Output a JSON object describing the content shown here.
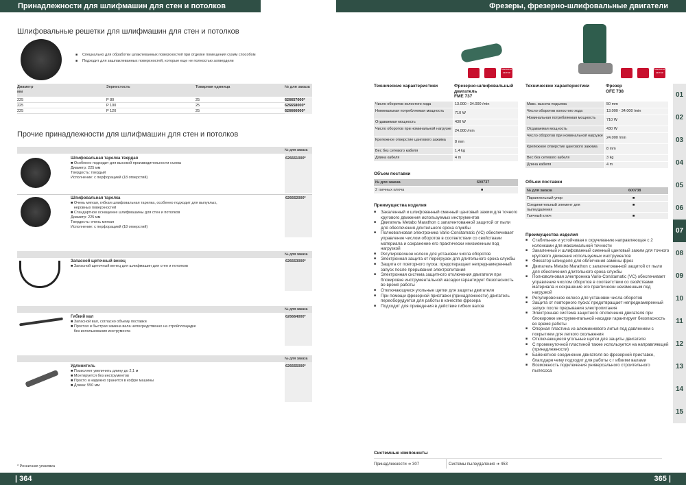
{
  "left": {
    "header": "Принадлежности для шлифмашин для стен и потолков",
    "page": "| 364",
    "sec1": "Шлифовальные решетки для шлифмашин для стен и потолков",
    "sec1_b1": "Специально для обработки шпаклеванных поверхностей при отделке помещения сухим способом",
    "sec1_b2": "Подходит для зашпаклеванных поверхностей, которые еще не полностью затвердели",
    "t1_cols": [
      "Диаметр",
      "Зернистость",
      "Товарная единица",
      "№ для заказа"
    ],
    "t1_unit": "мм",
    "t1_rows": [
      [
        "225",
        "P 80",
        "25",
        "626657000*"
      ],
      [
        "225",
        "P 100",
        "25",
        "626658000*"
      ],
      [
        "225",
        "P 120",
        "25",
        "626666000*"
      ]
    ],
    "sec2": "Прочие принадлежности для шлифмашин для стен и потолков",
    "ord_label": "№ для заказа",
    "p1": {
      "title": "Шлифовальная тарелка твердая",
      "b1": "Особенно подходит для высокой производительности съема",
      "l1": "Диаметр: 225 мм",
      "l2": "Твердость: твердый",
      "l3": "Исполнение: с перфорацией (18 отверстий)",
      "ord": "626661000*"
    },
    "p2": {
      "title": "Шлифовальная тарелка",
      "b1": "Очень мягкая, гибкая шлифовальная тарелка, особенно подходит для выпуклых,",
      "b1b": "неровных поверхностей",
      "b2": "Стандартное оснащение шлифмашины для стен и потолков",
      "l1": "Диаметр: 225 мм",
      "l2": "Твердость: очень мягкая",
      "l3": "Исполнение: с перфорацией (18 отверстий)",
      "ord": "626662000*"
    },
    "p3": {
      "title": "Запасной щеточный венец",
      "b1": "Запасной щеточный венец для шлифмашин для стен и потолков",
      "ord": "626663000*"
    },
    "p4": {
      "title": "Гибкий вал",
      "b1": "Запасной вал, согласно объему поставки",
      "b2": "Простая и быстрая замена вала непосредственно на стройплощадке",
      "b2b": "без использования инструмента",
      "ord": "626664000*"
    },
    "p5": {
      "title": "Удлинитель",
      "b1": "Позволяет увеличить длину до 2,1 м",
      "b2": "Монтируется без инструментов",
      "b3": "Просто и надежно хранится в кофре машины",
      "b4": "Длина: 550 мм",
      "ord": "626665000*"
    },
    "footnote": "* Розничная упаковка"
  },
  "right": {
    "header": "Фрезеры, фрезерно-шлифовальные двигатели",
    "page": "365 |",
    "tech_label": "Технические характеристики",
    "m1": {
      "name1": "Фрезерно-шлифовальный",
      "name2": "двигатель",
      "name3": "FME 737",
      "specs": [
        [
          "Число оборотов холостого хода",
          "13.000 - 34.000 /min"
        ],
        [
          "Номинальная потребляемая мощность",
          "710 W"
        ],
        [
          "Отдаваемая мощность",
          "430 W"
        ],
        [
          "Число оборотов при номинальной нагрузке",
          "24.000 /min"
        ],
        [
          "Крепежное отверстие цангового зажима",
          "8 mm"
        ],
        [
          "Вес без сетевого кабеля",
          "1,4 kg"
        ],
        [
          "Длина кабеля",
          "4 m"
        ]
      ],
      "delivery": "Объем поставки",
      "ord_label": "№ для заказа",
      "ord": "600737",
      "items": [
        [
          "2 гаечных ключа",
          "■"
        ]
      ],
      "adv": "Преимущества изделия",
      "bullets": [
        "Закаленный и шлифованный сменный цанговый зажим для точного кругового движения используемых инструментов",
        "Двигатель Metabo Marathon с запатентованной защитой от пыли для обеспечения длительного срока службы",
        "Полноволновая электроника Vario-Constamatic (VC) обеспечивает управление числом оборотов в соответствии со свойствами материала и сохранение его практически неизменным под нагрузкой",
        "Регулировочное колесо для установки числа оборотов",
        "Электронная защита от перегрузок для длительного срока службы",
        "Защита от повторного пуска: предотвращает непреднамеренный запуск после прерывания электропитания",
        "Электронная система защитного отключения двигателя при блокировке инструментальной насадки гарантирует безопасность во время работы",
        "Отключающиеся угольные щетки для защиты двигателя",
        "При помощи фрезерной приставки (принадлежности) двигатель переоборудуется для работы в качестве фрезера",
        "Подходит для приведения в действие гибких валов"
      ]
    },
    "m2": {
      "name1": "Фрезер",
      "name2": "OFE 738",
      "specs": [
        [
          "Макс. высота подъема",
          "50 mm"
        ],
        [
          "Число оборотов холостого хода",
          "13.000 - 34.000 /min"
        ],
        [
          "Номинальная потребляемая мощность",
          "710 W"
        ],
        [
          "Отдаваемая мощность",
          "430 W"
        ],
        [
          "Число оборотов при номинальной нагрузке",
          "24.000 /min"
        ],
        [
          "Крепежное отверстие цангового зажима",
          "8 mm"
        ],
        [
          "Вес без сетевого кабеля",
          "3 kg"
        ],
        [
          "Длина кабеля",
          "4 m"
        ]
      ],
      "delivery": "Объем поставки",
      "ord_label": "№ для заказа",
      "ord": "600738",
      "items": [
        [
          "Параллельный упор",
          "■"
        ],
        [
          "Соединительный элемент для пылеудаления",
          "■"
        ],
        [
          "Гаечный ключ",
          "■"
        ]
      ],
      "adv": "Преимущества изделия",
      "bullets": [
        "Стабильная и устойчивая к скручиванию направляющая с 2 колонками для максимальной точности",
        "Закаленный и шлифованный сменный цанговый зажим для точного кругового движения используемых инструментов",
        "Фиксатор шпинделя для облегчения замены фрез",
        "Двигатель Metabo Marathon с запатентованной защитой от пыли для обеспечения длительного срока службы",
        "Полноволновая электроника Vario-Constamatic (VC) обеспечивает управление числом оборотов в соответствии со свойствами материала и сохранение его практически неизменным под нагрузкой",
        "Регулировочное колесо для установки числа оборотов",
        "Защита от повторного пуска: предотвращает непреднамеренный запуск после прерывания электропитания",
        "Электронная система защитного отключения двигателя при блокировке инструментальной насадки гарантирует безопасность во время работы",
        "Опорная пластина из алюминиевого литья под давлением с покрытием для легкого скольжения",
        "Отключающиеся угольные щетки для защиты двигателя",
        "С промежуточной пластиной также используется на направляющей (принадлежности)",
        "Байонетное соединение двигателя во фрезерной приставке, благодаря чему подходит для работы с г ибкими валами",
        "Возможность подключения универсального строительного пылесоса"
      ]
    },
    "sys": "Системные компоненты",
    "sys1": "Принадлежности ➔ 307",
    "sys2": "Системы пылеудаления ➔ 453",
    "badge": "МАРАФОН МОТОР",
    "tabs": [
      "01",
      "02",
      "03",
      "04",
      "05",
      "06",
      "07",
      "08",
      "09",
      "10",
      "11",
      "12",
      "13",
      "14",
      "15"
    ]
  }
}
